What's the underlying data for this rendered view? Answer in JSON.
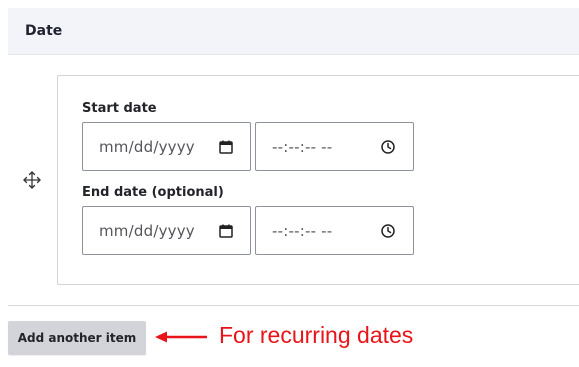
{
  "section": {
    "title": "Date"
  },
  "start_date": {
    "label": "Start date",
    "date_placeholder": "mm/dd/yyyy",
    "time_placeholder": "--:--:-- --"
  },
  "end_date": {
    "label": "End date (optional)",
    "date_placeholder": "mm/dd/yyyy",
    "time_placeholder": "--:--:-- --"
  },
  "add_button": {
    "label": "Add another item"
  },
  "annotation": {
    "text": "For recurring dates",
    "color": "#e8141a"
  },
  "icons": {
    "drag": "drag-move-icon",
    "calendar": "calendar-icon",
    "clock": "clock-icon"
  }
}
